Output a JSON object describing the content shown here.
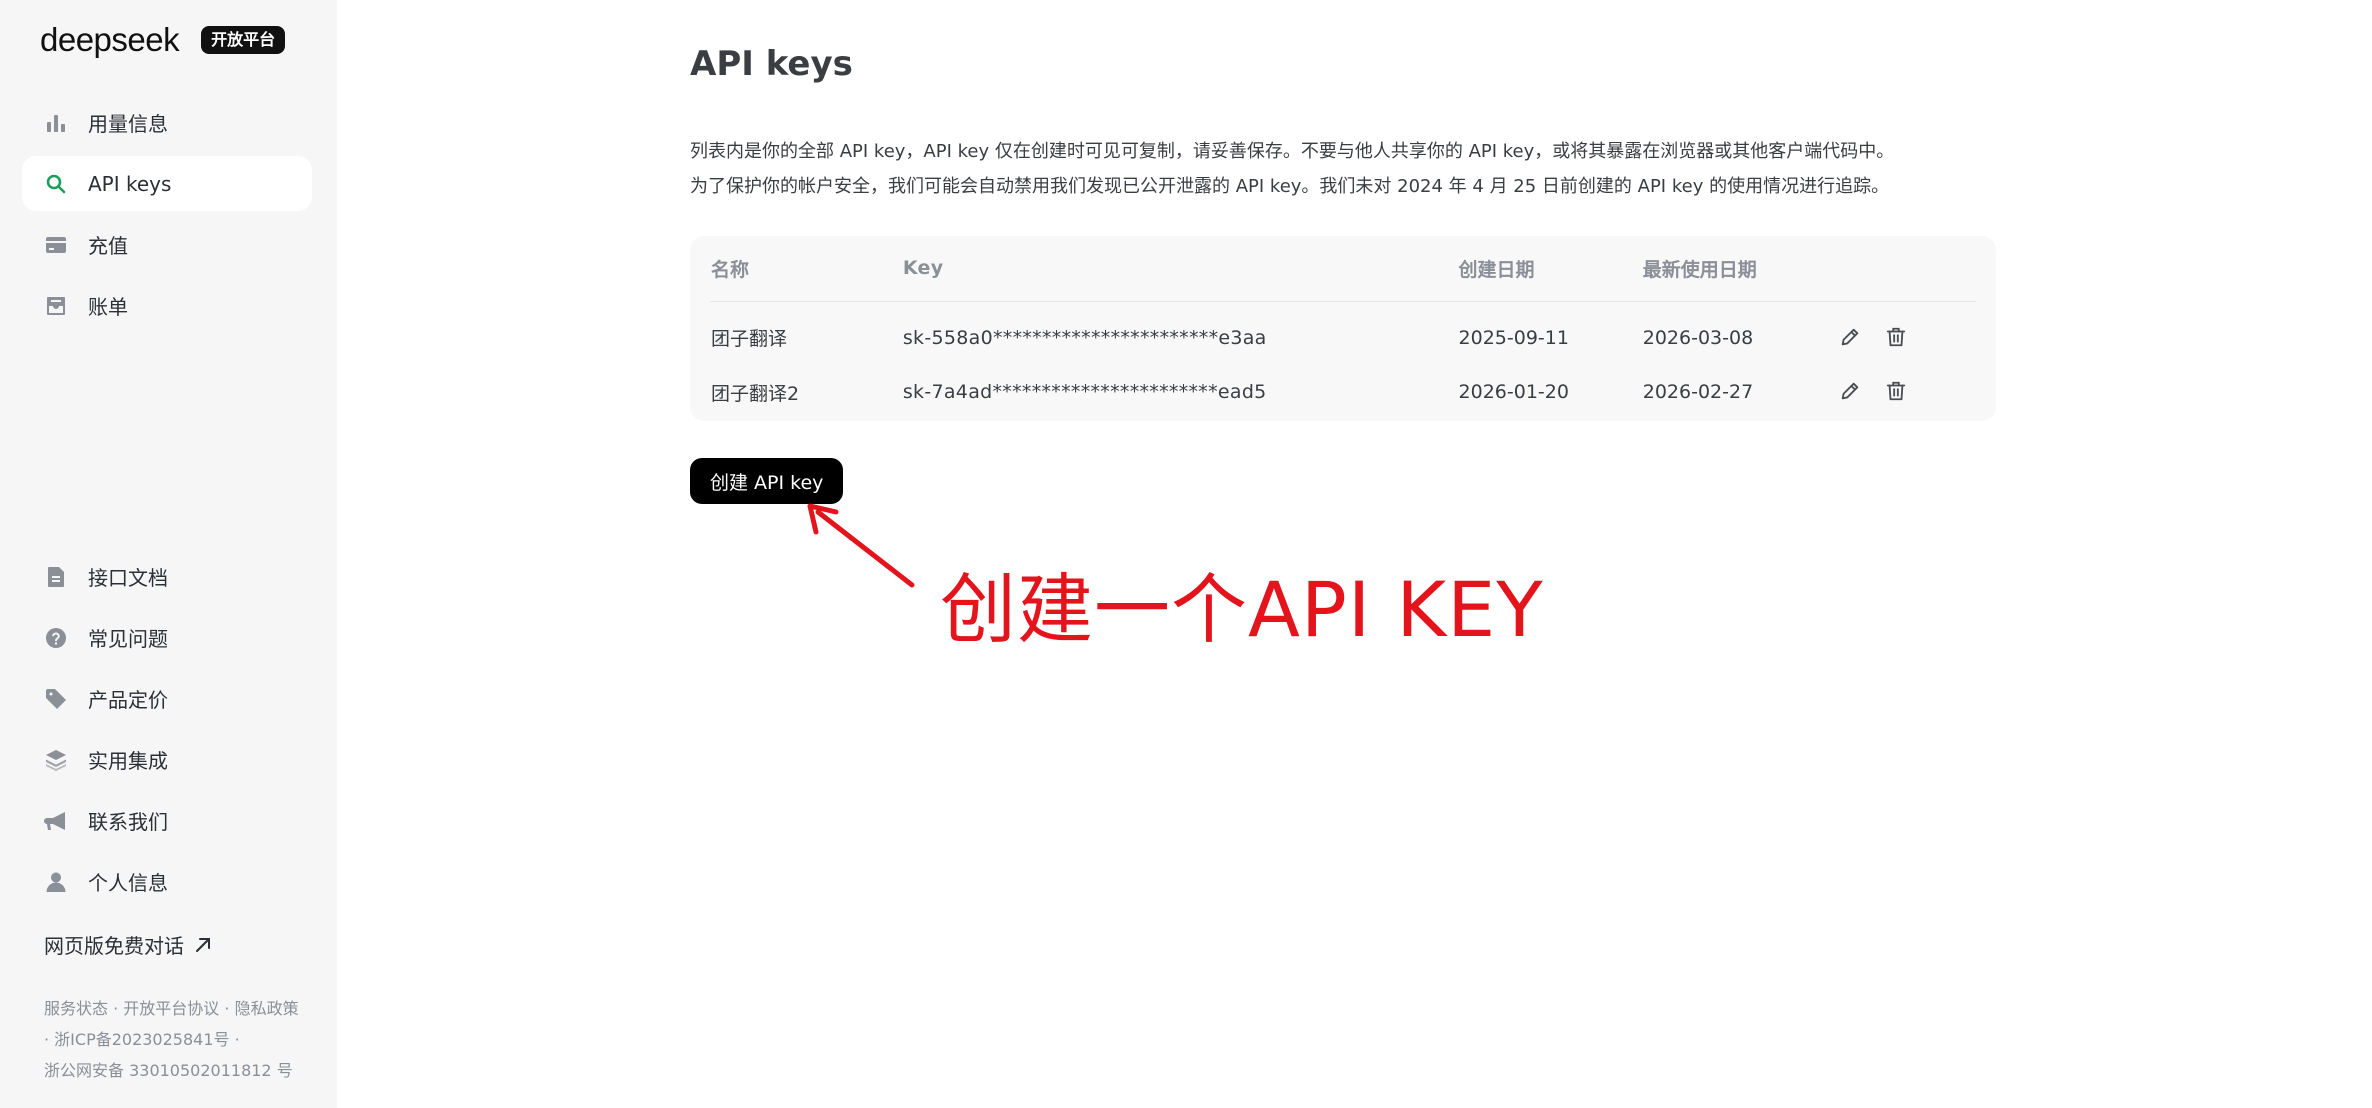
{
  "brand": {
    "name": "deepseek",
    "badge": "开放平台"
  },
  "sidebar": {
    "top_items": [
      {
        "label": "用量信息",
        "icon": "bar-chart-icon",
        "active": false
      },
      {
        "label": "API keys",
        "icon": "search-key-icon",
        "active": true
      },
      {
        "label": "充值",
        "icon": "card-icon",
        "active": false
      },
      {
        "label": "账单",
        "icon": "inbox-icon",
        "active": false
      }
    ],
    "bottom_items": [
      {
        "label": "接口文档",
        "icon": "document-icon"
      },
      {
        "label": "常见问题",
        "icon": "question-icon"
      },
      {
        "label": "产品定价",
        "icon": "tag-icon"
      },
      {
        "label": "实用集成",
        "icon": "layers-icon"
      },
      {
        "label": "联系我们",
        "icon": "megaphone-icon"
      },
      {
        "label": "个人信息",
        "icon": "user-icon"
      }
    ],
    "web_chat_label": "网页版免费对话",
    "footer": {
      "service_status": "服务状态",
      "platform_agreement": "开放平台协议",
      "privacy_policy": "隐私政策",
      "icp": "浙ICP备2023025841号",
      "police": "浙公网安备 33010502011812 号",
      "separator": " · "
    }
  },
  "main": {
    "title": "API keys",
    "description_line1": "列表内是你的全部 API key，API key 仅在创建时可见可复制，请妥善保存。不要与他人共享你的 API key，或将其暴露在浏览器或其他客户端代码中。",
    "description_line2": "为了保护你的帐户安全，我们可能会自动禁用我们发现已公开泄露的 API key。我们未对 2024 年 4 月 25 日前创建的 API key 的使用情况进行追踪。",
    "table": {
      "headers": {
        "name": "名称",
        "key": "Key",
        "created": "创建日期",
        "last_used": "最新使用日期"
      },
      "rows": [
        {
          "name": "团子翻译",
          "key": "sk-558a0***********************e3aa",
          "created": "2025-09-11",
          "last_used": "2026-03-08"
        },
        {
          "name": "团子翻译2",
          "key": "sk-7a4ad***********************ead5",
          "created": "2026-01-20",
          "last_used": "2026-02-27"
        }
      ]
    },
    "create_button": "创建 API key"
  },
  "annotation": {
    "text": "创建一个API KEY",
    "color": "#e3141c"
  },
  "colors": {
    "accent": "#1aa05b",
    "sidebar_bg": "#f6f6f6",
    "button_bg": "#000000"
  }
}
